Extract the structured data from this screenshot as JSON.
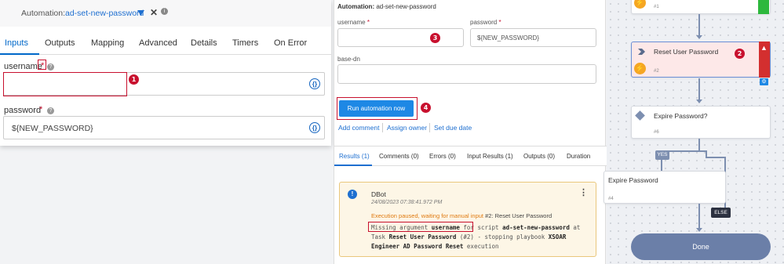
{
  "left_panel": {
    "automation_label": "Automation:",
    "automation_name": "ad-set-new-password",
    "tabs": [
      "Inputs",
      "Outputs",
      "Mapping",
      "Advanced",
      "Details",
      "Timers",
      "On Error"
    ],
    "username_label": "username",
    "username_req": "*",
    "username_value": "",
    "password_label": "password",
    "password_req": "*",
    "password_value": "${NEW_PASSWORD}",
    "brace_icon": "{}"
  },
  "middle_panel": {
    "automation_label": "Automation:",
    "automation_name": "ad-set-new-password",
    "username_label": "username",
    "password_label": "password",
    "req": "*",
    "password_value": "${NEW_PASSWORD}",
    "basedn_label": "base-dn",
    "run_button": "Run automation now",
    "links": [
      "Add comment",
      "Assign owner",
      "Set due date"
    ],
    "result_tabs": [
      "Results (1)",
      "Comments (0)",
      "Errors (0)",
      "Input Results (1)",
      "Outputs (0)",
      "Duration"
    ],
    "card": {
      "author": "DBot",
      "timestamp": "24/08/2023 07:38:41.972 PM",
      "status": "Execution paused, waiting for manual input",
      "task_ref": "#2: Reset User Password",
      "message_prefix": "Missing argument",
      "message_arg": "username",
      "message_mid": "for script",
      "message_script": "ad-set-new-password",
      "message_at": "at Task",
      "message_task": "Reset User Password",
      "message_task_num": "(#2) - stopping playbook",
      "message_playbook": "XSOAR Engineer AD Password Reset",
      "message_end": "execution"
    }
  },
  "canvas": {
    "top_node_num": "#1",
    "reset_node_title": "Reset User Password",
    "reset_node_num": "#2",
    "expire_node_title": "Expire Password?",
    "expire_node_num": "#6",
    "yes_label": "YES",
    "expire_pw_title": "Expire Password",
    "expire_pw_num": "#4",
    "else_label": "ELSE",
    "done_label": "Done",
    "colors": {
      "green": "#2db83d",
      "error_red": "#d32f2f",
      "done_blue": "#6b7fa8"
    }
  },
  "callouts": [
    "1",
    "2",
    "3",
    "4"
  ]
}
